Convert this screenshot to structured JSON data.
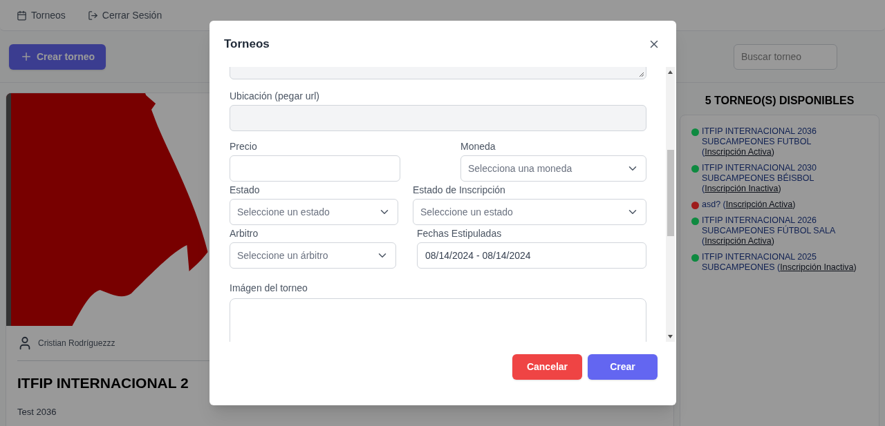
{
  "nav": [
    {
      "kind": "calendar",
      "label": "Torneos"
    },
    {
      "kind": "logout",
      "label": "Cerrar Sesión"
    }
  ],
  "create_button": "Crear torneo",
  "search": {
    "placeholder": "Buscar torneo"
  },
  "card": {
    "kind": "picture",
    "author": "Cristian Rodríguezzz",
    "title": "ITFIP INTERNACIONAL 2",
    "description": "Test 2036"
  },
  "sidebar": {
    "heading": "5 TORNEO(S) DISPONIBLES",
    "items": [
      {
        "color": "#0e8a40",
        "text": "ITFIP INTERNACIONAL 2036 SUBCAMPEONES FUTBOL (",
        "link": "Inscripción Activa",
        "suffix": ")"
      },
      {
        "color": "#0e8a40",
        "text": "ITFIP INTERNACIONAL 2030 SUBCAMPEONES BÉISBOL (",
        "link": "Inscripción Inactiva",
        "suffix": ")"
      },
      {
        "color": "#9e1c1c",
        "text": "asd? (",
        "link": "Inscripción Activa",
        "suffix": ")"
      },
      {
        "color": "#0e8a40",
        "text": "ITFIP INTERNACIONAL 2026 SUBCAMPEONES FÚTBOL SALA (",
        "link": "Inscripción Activa",
        "suffix": ")"
      },
      {
        "color": "#0e8a40",
        "text": "ITFIP INTERNACIONAL 2025 SUBCAMPEONES (",
        "link": "Inscripción Inactiva",
        "suffix": ")"
      }
    ]
  },
  "modal": {
    "title": "Torneos",
    "rows": [
      [
        {
          "kind": "textarea"
        }
      ],
      [
        {
          "kind": "text",
          "label": "Ubicación (pegar url)",
          "disabled": true
        }
      ],
      [
        {
          "kind": "text",
          "label": "Precio",
          "disabled": false
        },
        {
          "kind": "select",
          "label": "Moneda",
          "placeholder": "Selecciona una moneda"
        }
      ],
      [
        {
          "kind": "select",
          "label": "Estado",
          "placeholder": "Seleccione un estado"
        },
        {
          "kind": "select",
          "label": "Estado de Inscripción",
          "placeholder": "Seleccione un estado"
        }
      ],
      [
        {
          "kind": "select",
          "label": "Arbitro",
          "placeholder": "Seleccione un árbitro"
        },
        {
          "kind": "date",
          "label": "Fechas Estipuladas",
          "value": "08/14/2024 - 08/14/2024"
        }
      ],
      [
        {
          "label": "Imágen del torneo"
        }
      ]
    ],
    "cancel": "Cancelar",
    "submit": "Crear"
  }
}
